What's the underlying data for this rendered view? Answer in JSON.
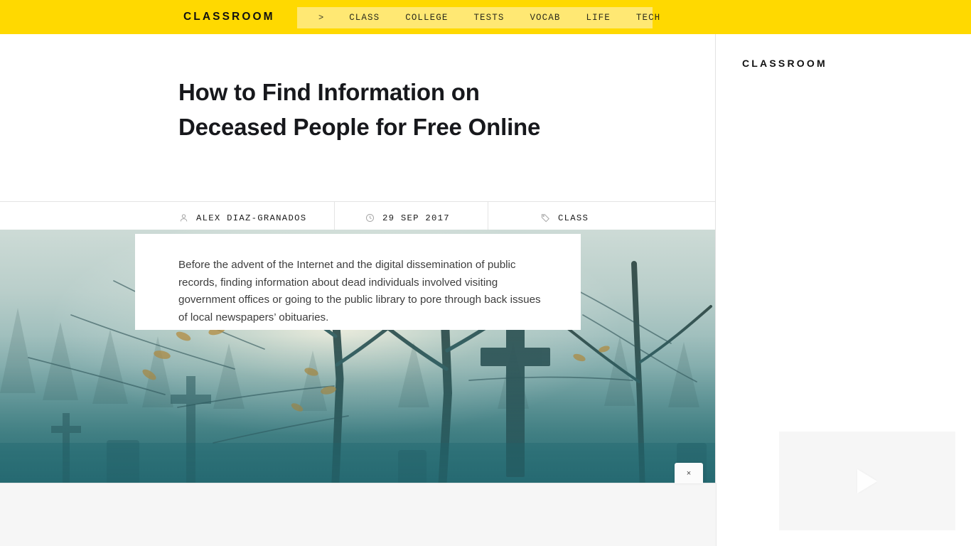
{
  "header": {
    "brand": "CLASSROOM",
    "nav_caret": ">",
    "nav_items": [
      {
        "label": "CLASS"
      },
      {
        "label": "COLLEGE"
      },
      {
        "label": "TESTS"
      },
      {
        "label": "VOCAB"
      },
      {
        "label": "LIFE"
      },
      {
        "label": "TECH"
      }
    ],
    "bar_color": "#ffd900",
    "panel_color": "#ffe873"
  },
  "article": {
    "title": "How to Find Information on Deceased People for Free Online",
    "meta": {
      "author_icon": "person-icon",
      "author": "ALEX DIAZ-GRANADOS",
      "date_icon": "clock-icon",
      "date": "29 SEP 2017",
      "category_icon": "tag-icon",
      "category": "CLASS"
    },
    "hero_image_alt": "foggy cemetery with bare trees and a stone cross",
    "excerpt": "Before the advent of the Internet and the digital dissemination of public records, finding information about dead individuals involved visiting government offices or going to the public library to pore through back issues of local newspapers’ obituaries."
  },
  "overlay": {
    "close_label": "×"
  },
  "sidebar": {
    "brand": "CLASSROOM",
    "video_icon": "play-icon"
  }
}
